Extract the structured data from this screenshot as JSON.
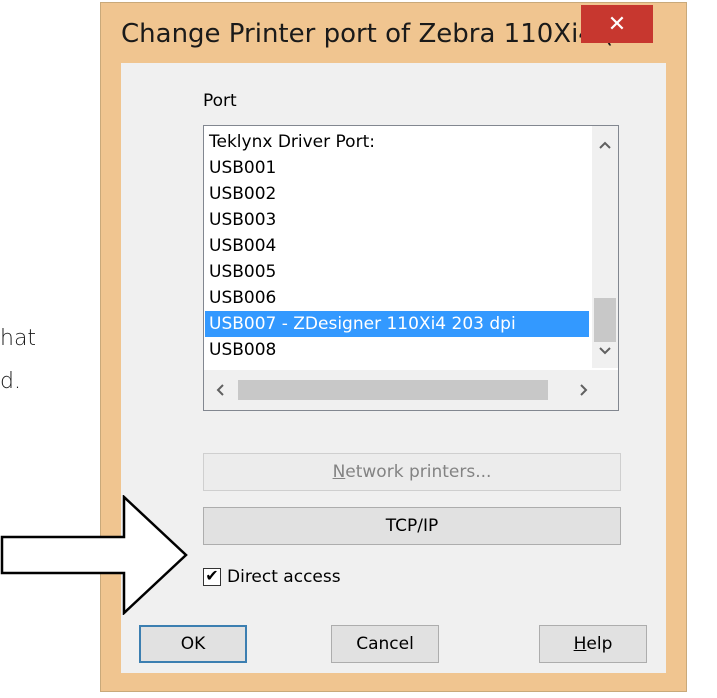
{
  "background": {
    "line1": "hat",
    "line2": "d."
  },
  "dialog": {
    "title": "Change Printer port of  Zebra 110Xi4 (...",
    "close_glyph": "✕",
    "port_label": "Port",
    "ports": [
      "Teklynx Driver Port:",
      "USB001",
      "USB002",
      "USB003",
      "USB004",
      "USB005",
      "USB006",
      "USB007 - ZDesigner 110Xi4 203 dpi",
      "USB008"
    ],
    "selected_port": "USB007 - ZDesigner 110Xi4 203 dpi",
    "network_button": {
      "prefix": "N",
      "rest": "etwork printers..."
    },
    "tcp_button": "TCP/IP",
    "direct_access": {
      "label": "Direct access",
      "checked": true
    },
    "ok_button": "OK",
    "cancel_button": "Cancel",
    "help_button": {
      "prefix": "H",
      "rest": "elp"
    }
  },
  "icons": {
    "scroll_up": "chevron-up-icon",
    "scroll_down": "chevron-down-icon",
    "scroll_left": "chevron-left-icon",
    "scroll_right": "chevron-right-icon",
    "checkmark": "check-icon",
    "annotation": "annotation-arrow-icon"
  },
  "colors": {
    "selection": "#3399ff",
    "close": "#c7372f",
    "frame": "#f0c590"
  }
}
